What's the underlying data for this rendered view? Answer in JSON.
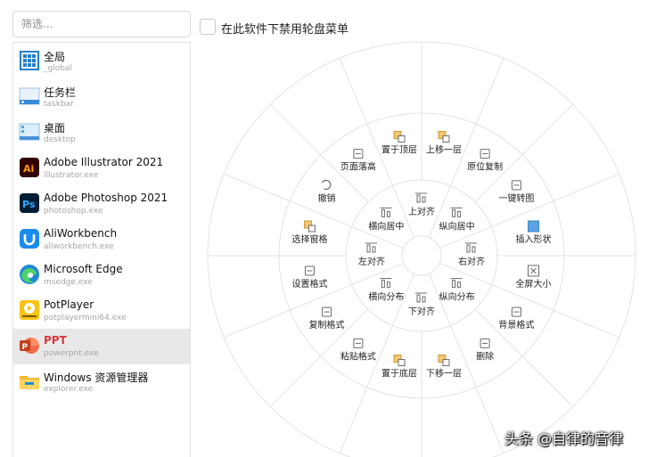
{
  "search": {
    "placeholder": "筛选..."
  },
  "apps": [
    {
      "name": "全局",
      "exe": "_global",
      "icon": "grid-app-icon",
      "selected": false
    },
    {
      "name": "任务栏",
      "exe": "taskbar",
      "icon": "taskbar-icon",
      "selected": false
    },
    {
      "name": "桌面",
      "exe": "desktop",
      "icon": "desktop-icon",
      "selected": false
    },
    {
      "name": "Adobe Illustrator 2021",
      "exe": "illustrator.exe",
      "icon": "illustrator-icon",
      "selected": false
    },
    {
      "name": "Adobe Photoshop 2021",
      "exe": "photoshop.exe",
      "icon": "photoshop-icon",
      "selected": false
    },
    {
      "name": "AliWorkbench",
      "exe": "aliworkbench.exe",
      "icon": "aliworkbench-icon",
      "selected": false
    },
    {
      "name": "Microsoft Edge",
      "exe": "msedge.exe",
      "icon": "edge-icon",
      "selected": false
    },
    {
      "name": "PotPlayer",
      "exe": "potplayermini64.exe",
      "icon": "potplayer-icon",
      "selected": false
    },
    {
      "name": "PPT",
      "exe": "powerpnt.exe",
      "icon": "powerpoint-icon",
      "selected": true
    },
    {
      "name": "Windows 资源管理器",
      "exe": "explorer.exe",
      "icon": "explorer-icon",
      "selected": false
    }
  ],
  "disable_checkbox": {
    "label": "在此软件下禁用轮盘菜单",
    "checked": false
  },
  "wheel": {
    "inner_ring": [
      {
        "label": "上对齐",
        "icon": "align-top-icon"
      },
      {
        "label": "纵向居中",
        "icon": "align-vertical-center-icon"
      },
      {
        "label": "右对齐",
        "icon": "align-right-icon"
      },
      {
        "label": "纵向分布",
        "icon": "distribute-vertical-icon"
      },
      {
        "label": "下对齐",
        "icon": "align-bottom-icon"
      },
      {
        "label": "横向分布",
        "icon": "distribute-horizontal-icon"
      },
      {
        "label": "左对齐",
        "icon": "align-left-icon"
      },
      {
        "label": "横向居中",
        "icon": "align-horizontal-center-icon"
      }
    ],
    "middle_ring": [
      {
        "label": "上移一层",
        "icon": "bring-forward-icon"
      },
      {
        "label": "原位复制",
        "icon": "duplicate-in-place-icon"
      },
      {
        "label": "一键转图",
        "icon": "convert-to-image-icon"
      },
      {
        "label": "插入形状",
        "icon": "insert-shape-icon"
      },
      {
        "label": "全屏大小",
        "icon": "fullscreen-size-icon"
      },
      {
        "label": "背景格式",
        "icon": "background-format-icon"
      },
      {
        "label": "删除",
        "icon": "delete-icon"
      },
      {
        "label": "下移一层",
        "icon": "send-backward-icon"
      },
      {
        "label": "置于底层",
        "icon": "send-to-back-icon"
      },
      {
        "label": "粘贴格式",
        "icon": "paste-format-icon"
      },
      {
        "label": "复制格式",
        "icon": "copy-format-icon"
      },
      {
        "label": "设置格式",
        "icon": "format-settings-icon"
      },
      {
        "label": "选择窗格",
        "icon": "selection-pane-icon"
      },
      {
        "label": "撤销",
        "icon": "undo-icon"
      },
      {
        "label": "页面落高",
        "icon": "page-height-icon"
      },
      {
        "label": "置于顶层",
        "icon": "bring-to-front-icon"
      }
    ],
    "outer_ring_slots": 16
  },
  "watermark": "头条 @自律的音律",
  "colors": {
    "selected_row_bg": "#e8e8e8",
    "selected_text": "#d7383c",
    "wheel_line": "#e3e3e3",
    "insert_shape_fill": "#5aa3e6"
  }
}
